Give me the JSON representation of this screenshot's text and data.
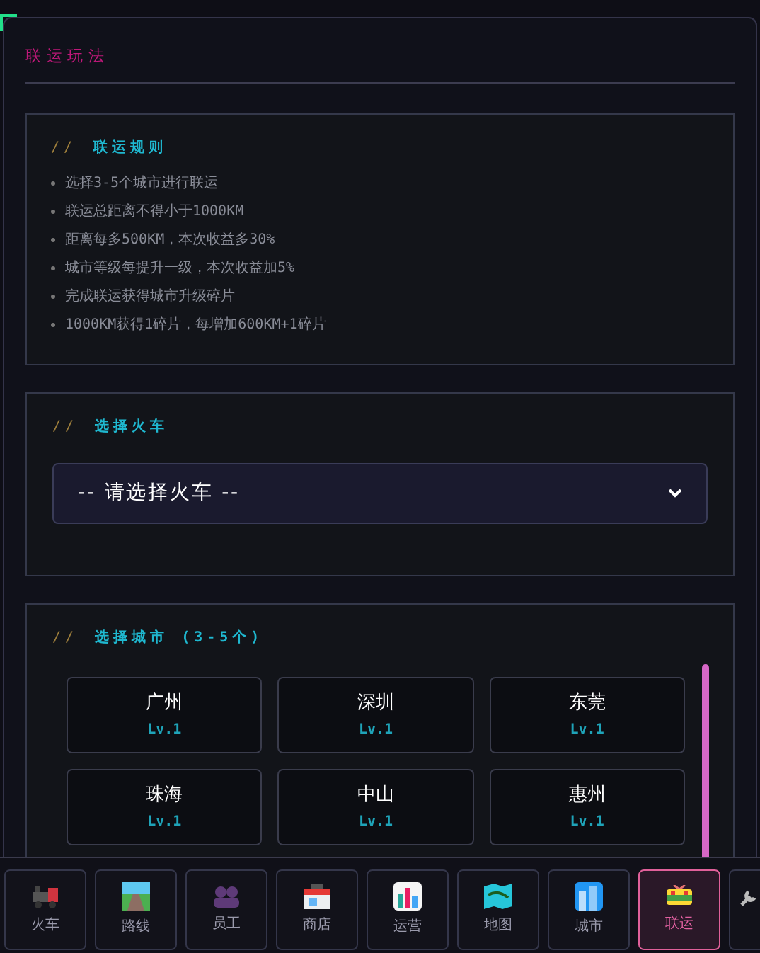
{
  "panel": {
    "title": "联运玩法"
  },
  "rules": {
    "prefix": "//",
    "title": "联运规则",
    "items": [
      "选择3-5个城市进行联运",
      "联运总距离不得小于1000KM",
      "距离每多500KM，本次收益多30%",
      "城市等级每提升一级，本次收益加5%",
      "完成联运获得城市升级碎片",
      "1000KM获得1碎片，每增加600KM+1碎片"
    ]
  },
  "train_select": {
    "prefix": "//",
    "title": "选择火车",
    "value": "-- 请选择火车 --"
  },
  "city_select": {
    "prefix": "//",
    "title": "选择城市 (3-5个)",
    "cities": [
      {
        "name": "广州",
        "level": "Lv.1"
      },
      {
        "name": "深圳",
        "level": "Lv.1"
      },
      {
        "name": "东莞",
        "level": "Lv.1"
      },
      {
        "name": "珠海",
        "level": "Lv.1"
      },
      {
        "name": "中山",
        "level": "Lv.1"
      },
      {
        "name": "惠州",
        "level": "Lv.1"
      }
    ]
  },
  "nav": [
    {
      "label": "火车",
      "selected": false
    },
    {
      "label": "路线",
      "selected": false
    },
    {
      "label": "员工",
      "selected": false
    },
    {
      "label": "商店",
      "selected": false
    },
    {
      "label": "运营",
      "selected": false
    },
    {
      "label": "地图",
      "selected": false
    },
    {
      "label": "城市",
      "selected": false
    },
    {
      "label": "联运",
      "selected": true
    }
  ]
}
